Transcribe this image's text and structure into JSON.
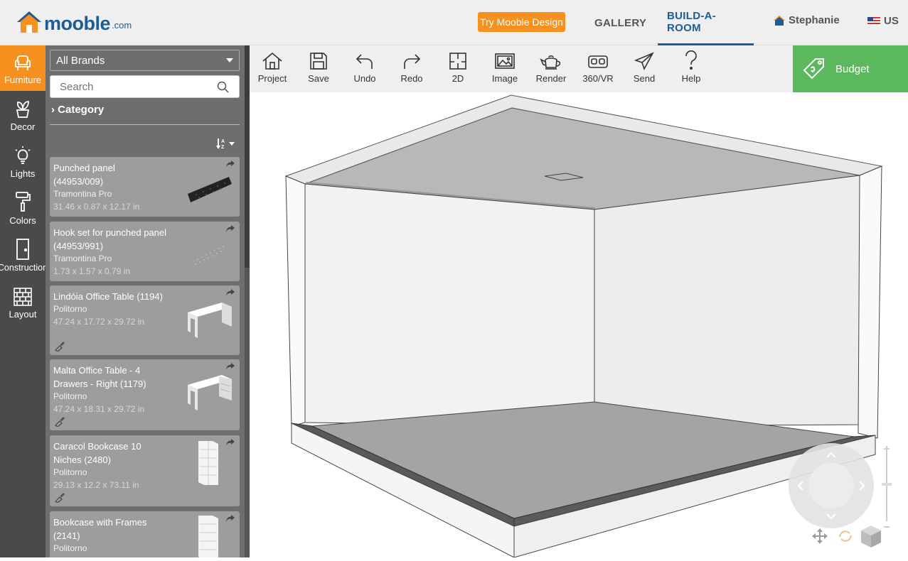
{
  "header": {
    "logo_text": "mooble",
    "logo_suffix": ".com",
    "try_button": "Try Mooble Design",
    "nav": [
      "GALLERY",
      "BUILD-A-ROOM"
    ],
    "active_nav": "BUILD-A-ROOM",
    "user_name": "Stephanie",
    "locale": "US",
    "accent_color": "#f6901e",
    "brand_color": "#1d5c94"
  },
  "categories": [
    {
      "label": "Furniture",
      "icon": "armchair-icon",
      "active": true
    },
    {
      "label": "Decor",
      "icon": "plant-icon"
    },
    {
      "label": "Lights",
      "icon": "lightbulb-icon"
    },
    {
      "label": "Colors",
      "icon": "paint-roller-icon"
    },
    {
      "label": "Construction",
      "icon": "door-icon"
    },
    {
      "label": "Layout",
      "icon": "brick-wall-icon"
    }
  ],
  "panel": {
    "brand_select": "All Brands",
    "search_placeholder": "Search",
    "category_label": "Category",
    "products": [
      {
        "name_line1": "Punched panel",
        "name_line2": "(44953/009)",
        "maker": "Tramontina Pro",
        "dims": "31.46 x 0.87 x 12.17 in"
      },
      {
        "name_line1": "Hook set for punched panel",
        "name_line2": "(44953/991)",
        "maker": "Tramontina Pro",
        "dims": "1.73 x 1.57 x 0.79 in"
      },
      {
        "name_line1": "Lindóia Office Table (1194)",
        "name_line2": "",
        "maker": "Politorno",
        "dims": "47.24 x 17.72 x 29.72 in"
      },
      {
        "name_line1": "Malta Office Table - 4",
        "name_line2": "Drawers - Right (1179)",
        "maker": "Politorno",
        "dims": "47.24 x 18.31 x 29.72 in"
      },
      {
        "name_line1": "Caracol Bookcase 10",
        "name_line2": "Niches (2480)",
        "maker": "Politorno",
        "dims": "29.13 x 12.2 x 73.11 in"
      },
      {
        "name_line1": "Bookcase with Frames",
        "name_line2": "(2141)",
        "maker": "Politorno",
        "dims": ""
      }
    ]
  },
  "toolbar": {
    "tools": [
      "Project",
      "Save",
      "Undo",
      "Redo",
      "2D",
      "Image",
      "Render",
      "360/VR",
      "Send",
      "Help"
    ],
    "budget_label": "Budget",
    "budget_color": "#5cb85c"
  }
}
